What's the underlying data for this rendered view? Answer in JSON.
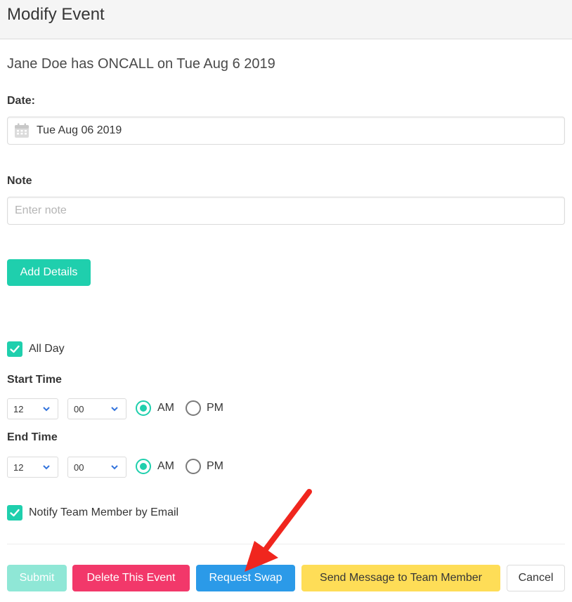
{
  "header": {
    "title": "Modify Event"
  },
  "event": {
    "summary": "Jane Doe has ONCALL on Tue Aug 6 2019"
  },
  "date": {
    "label": "Date:",
    "value": "Tue Aug 06 2019"
  },
  "note": {
    "label": "Note",
    "placeholder": "Enter note",
    "value": ""
  },
  "add_details": {
    "label": "Add Details"
  },
  "all_day": {
    "label": "All Day",
    "checked": true
  },
  "start_time": {
    "label": "Start Time",
    "hour": "12",
    "minute": "00",
    "am_label": "AM",
    "pm_label": "PM",
    "period": "AM"
  },
  "end_time": {
    "label": "End Time",
    "hour": "12",
    "minute": "00",
    "am_label": "AM",
    "pm_label": "PM",
    "period": "AM"
  },
  "notify": {
    "label": "Notify Team Member by Email",
    "checked": true
  },
  "actions": {
    "submit": "Submit",
    "delete": "Delete This Event",
    "swap": "Request Swap",
    "message": "Send Message to Team Member",
    "cancel": "Cancel"
  },
  "colors": {
    "primary": "#1fcfad",
    "danger": "#f2386a",
    "info": "#2b9ae8",
    "warning": "#fedd57",
    "annotation_arrow": "#f0261e"
  },
  "icons": {
    "date": "calendar-icon",
    "select": "chevron-down-icon",
    "check": "checkmark-icon",
    "annotation": "red-arrow-icon"
  }
}
